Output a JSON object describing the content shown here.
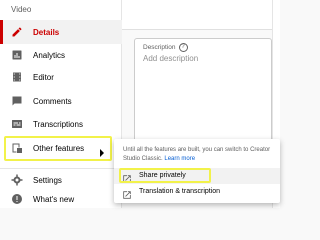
{
  "sidebar": {
    "section_label": "Video",
    "items": [
      {
        "label": "Details",
        "icon": "pencil-icon",
        "active": true
      },
      {
        "label": "Analytics",
        "icon": "bar-chart-icon"
      },
      {
        "label": "Editor",
        "icon": "film-icon"
      },
      {
        "label": "Comments",
        "icon": "comment-icon"
      },
      {
        "label": "Transcriptions",
        "icon": "subtitles-icon"
      },
      {
        "label": "Other features",
        "icon": "other-features-icon"
      }
    ],
    "bottom_items": [
      {
        "label": "Settings",
        "icon": "gear-icon"
      },
      {
        "label": "What's new",
        "icon": "alert-icon"
      }
    ]
  },
  "description": {
    "label": "Description",
    "placeholder": "Add description"
  },
  "popup": {
    "text": "Until all the features are built, you can switch to Creator Studio Classic.",
    "link": "Learn more",
    "items": [
      {
        "label": "Share privately",
        "icon": "open-external-icon"
      },
      {
        "label": "Translation & transcription",
        "icon": "open-external-icon"
      }
    ]
  },
  "colors": {
    "accent": "#cc0000",
    "link": "#065fd4",
    "highlight": "#f2f24a"
  }
}
